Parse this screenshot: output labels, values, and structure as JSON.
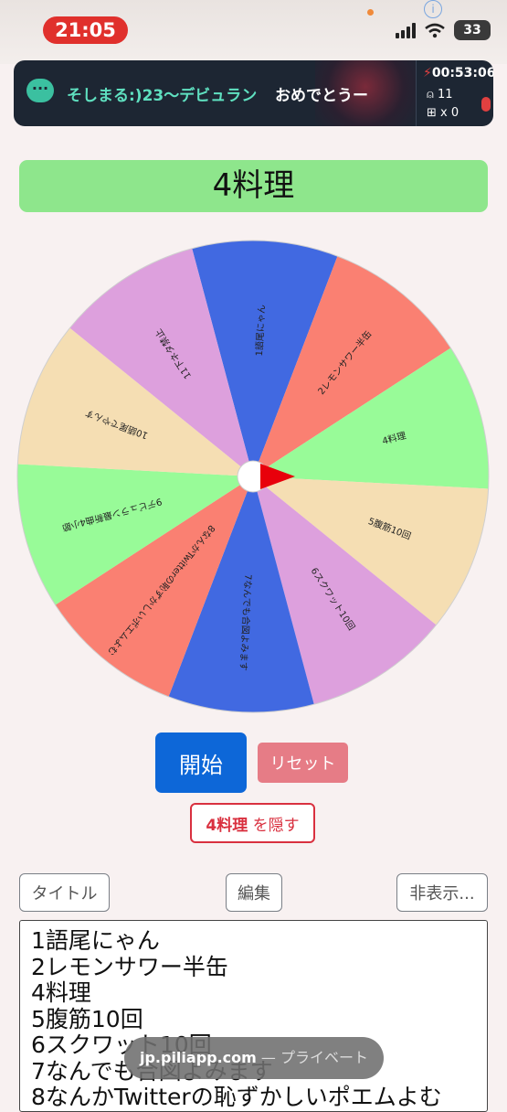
{
  "status_bar": {
    "time": "21:05",
    "battery": "33"
  },
  "live_banner": {
    "user": "そしまる:)23〜デビュラン",
    "message": "おめでとうー",
    "timer": "00:53:06",
    "viewers": "11",
    "gifts": "x 0"
  },
  "result": {
    "current": "4料理"
  },
  "wheel": {
    "segments": [
      {
        "label": "1語尾にゃん",
        "color": "#4169e1"
      },
      {
        "label": "2レモンサワー半缶",
        "color": "#fa8072"
      },
      {
        "label": "4料理",
        "color": "#98fb98"
      },
      {
        "label": "5腹筋10回",
        "color": "#f5deb3"
      },
      {
        "label": "6スクワット10回",
        "color": "#dda0dd"
      },
      {
        "label": "7なんでも合図よみます",
        "color": "#4169e1"
      },
      {
        "label": "8なんかTwitterの恥ずかしいポエムよむ",
        "color": "#fa8072"
      },
      {
        "label": "9デビュラン最新曲4小節",
        "color": "#98fb98"
      },
      {
        "label": "10語尾でやんす",
        "color": "#f5deb3"
      },
      {
        "label": "11下ネタ禁止",
        "color": "#dda0dd"
      }
    ],
    "pointer_color": "#e8000b"
  },
  "controls": {
    "start": "開始",
    "reset": "リセット",
    "hide_item": "4料理",
    "hide_suffix": "を隠す",
    "title": "タイトル",
    "edit": "編集",
    "hide_list": "非表示..."
  },
  "items_list": [
    "1語尾にゃん",
    "2レモンサワー半缶",
    "4料理",
    "5腹筋10回",
    "6スクワット10回",
    "7なんでも合図よみます",
    "8なんかTwitterの恥ずかしいポエムよむ"
  ],
  "browser": {
    "host": "jp.piliapp.com",
    "mode": "— プライベート"
  }
}
